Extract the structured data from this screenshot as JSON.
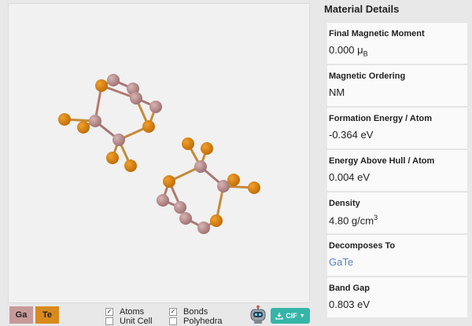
{
  "panel": {
    "title": "Material Details",
    "properties": [
      {
        "label": "Final Magnetic Moment",
        "value": "0.000 μ",
        "sub": "B"
      },
      {
        "label": "Magnetic Ordering",
        "value": "NM"
      },
      {
        "label": "Formation Energy / Atom",
        "value": "-0.364 eV"
      },
      {
        "label": "Energy Above Hull / Atom",
        "value": "0.004 eV"
      },
      {
        "label": "Density",
        "value": "4.80 g/cm",
        "sup": "3"
      },
      {
        "label": "Decomposes To",
        "value": "GaTe",
        "link": true
      },
      {
        "label": "Band Gap",
        "value": "0.803 eV"
      }
    ]
  },
  "toolbar": {
    "elements": [
      {
        "symbol": "Ga",
        "color": "#c79a9a"
      },
      {
        "symbol": "Te",
        "color": "#d98a1c"
      }
    ],
    "checkboxes": [
      {
        "label": "Atoms",
        "checked": true
      },
      {
        "label": "Unit Cell",
        "checked": false
      },
      {
        "label": "Bonds",
        "checked": true
      },
      {
        "label": "Polyhedra",
        "checked": false
      }
    ],
    "export_label": "CIF"
  },
  "colors": {
    "ga_atom": "#b08282",
    "te_atom": "#d47a08",
    "bond_ga": "#a97676",
    "bond_te": "#d28a1d",
    "accent": "#35b5a8"
  }
}
